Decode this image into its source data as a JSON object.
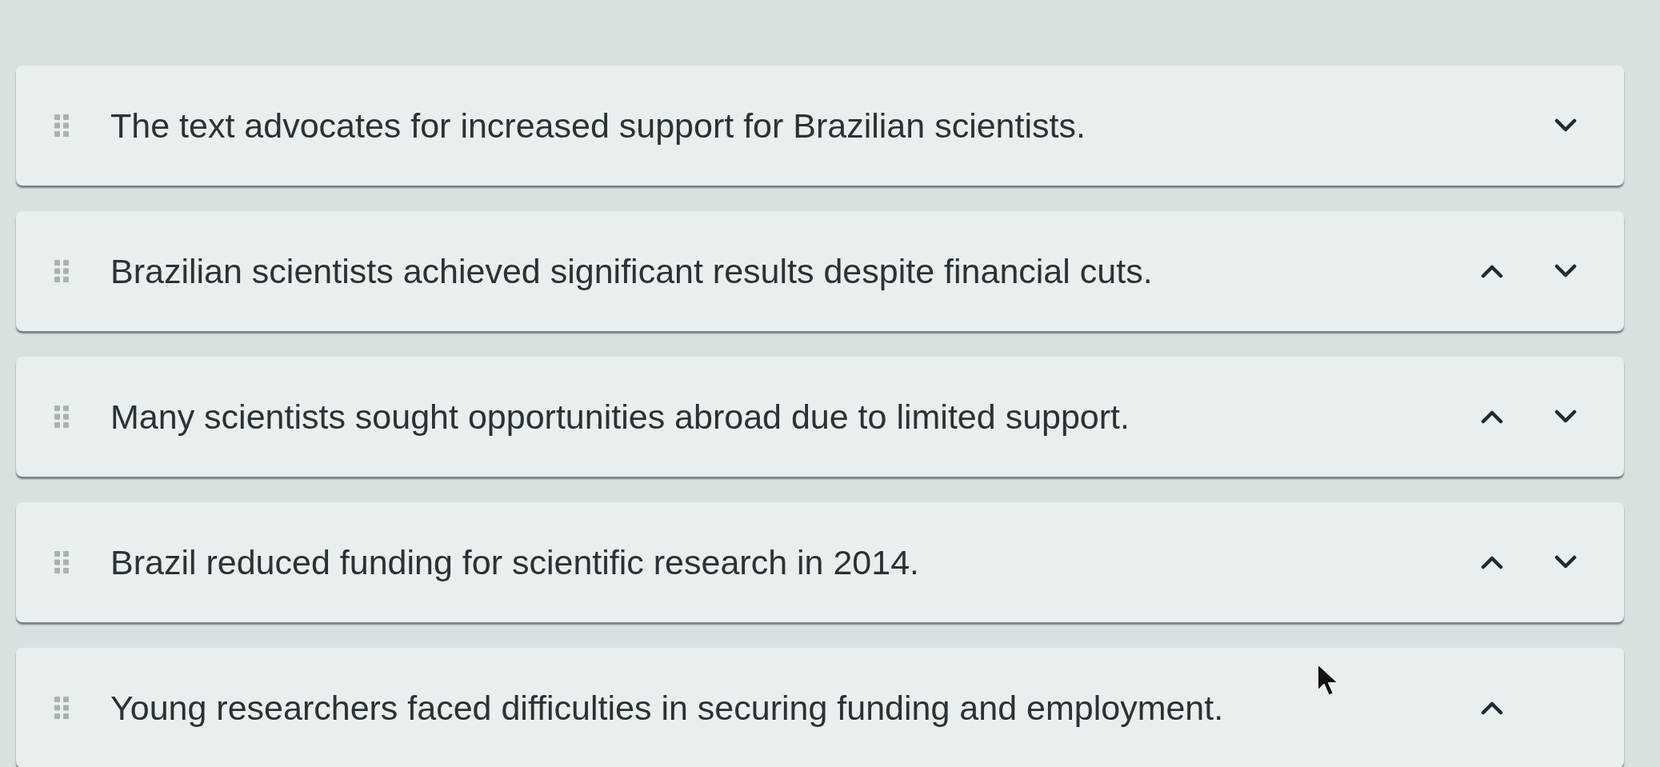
{
  "items": [
    {
      "text": "The text advocates for increased support for Brazilian scientists.",
      "move_up": false,
      "move_down": true
    },
    {
      "text": "Brazilian scientists achieved significant results despite financial cuts.",
      "move_up": true,
      "move_down": true
    },
    {
      "text": "Many scientists sought opportunities abroad due to limited support.",
      "move_up": true,
      "move_down": true
    },
    {
      "text": "Brazil reduced funding for scientific research in 2014.",
      "move_up": true,
      "move_down": true
    },
    {
      "text": "Young researchers faced difficulties in securing funding and employment.",
      "move_up": true,
      "move_down": false
    }
  ]
}
